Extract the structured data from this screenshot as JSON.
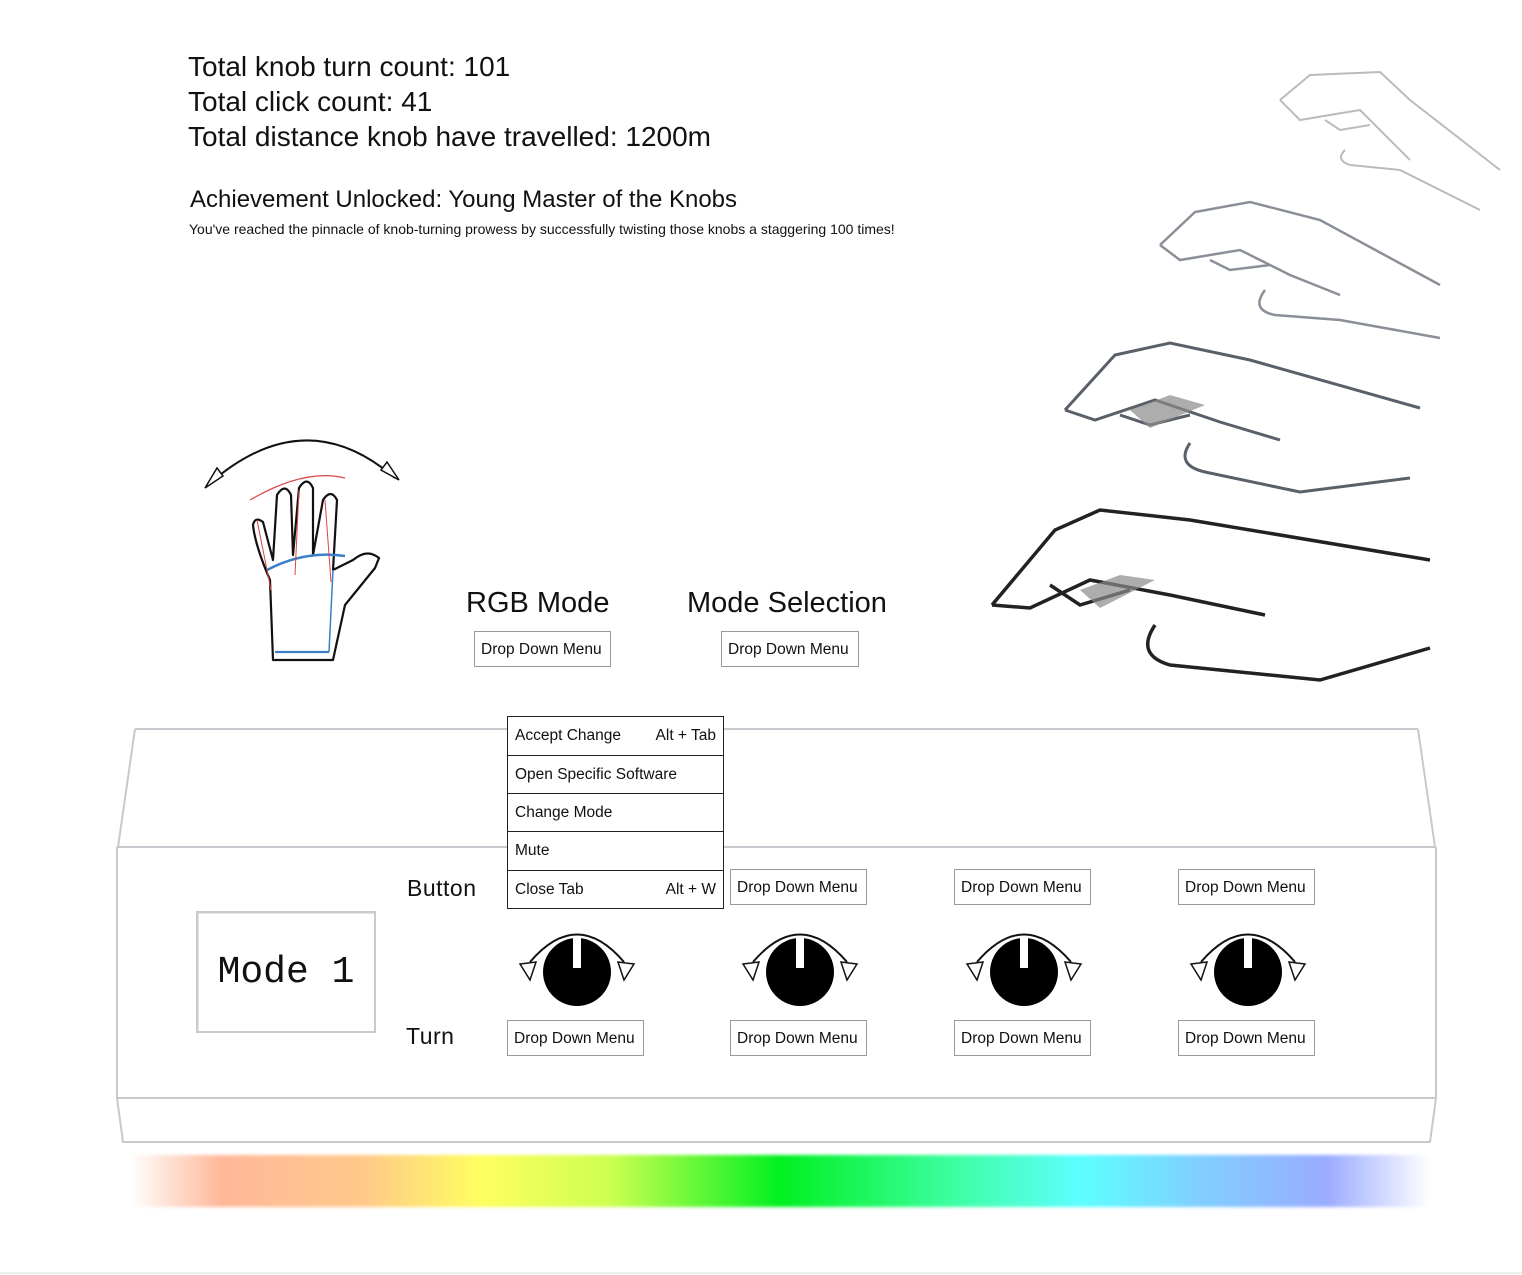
{
  "stats": {
    "turn_count": "Total knob turn count: 101",
    "click_count": "Total click count: 41",
    "distance": "Total distance knob have travelled: 1200m"
  },
  "achievement": {
    "title": "Achievement Unlocked: Young Master of the Knobs",
    "description": "You've reached the pinnacle of knob-turning prowess by successfully twisting those knobs a staggering 100 times!"
  },
  "rgb_mode": {
    "label": "RGB Mode",
    "dropdown": "Drop Down Menu"
  },
  "mode_selection": {
    "label": "Mode Selection",
    "dropdown": "Drop Down Menu"
  },
  "device": {
    "mode_display": "Mode 1",
    "button_label": "Button",
    "turn_label": "Turn",
    "button_dropdowns": [
      "Drop Down Menu",
      "Drop Down Menu",
      "Drop Down Menu"
    ],
    "turn_dropdowns": [
      "Drop Down Menu",
      "Drop Down Menu",
      "Drop Down Menu",
      "Drop Down Menu"
    ]
  },
  "context_menu": {
    "items": [
      {
        "label": "Accept Change",
        "shortcut": "Alt + Tab"
      },
      {
        "label": "Open Specific Software",
        "shortcut": ""
      },
      {
        "label": "Change Mode",
        "shortcut": ""
      },
      {
        "label": "Mute",
        "shortcut": ""
      },
      {
        "label": "Close Tab",
        "shortcut": "Alt + W"
      }
    ]
  },
  "icons": {
    "hand_sketch": "hand-wave-icon",
    "hands_typing": "typing-hands-illustration",
    "knob": "knob-rotate-icon"
  },
  "colors": {
    "knob": "#000000",
    "outline": "#c8c8cf"
  }
}
